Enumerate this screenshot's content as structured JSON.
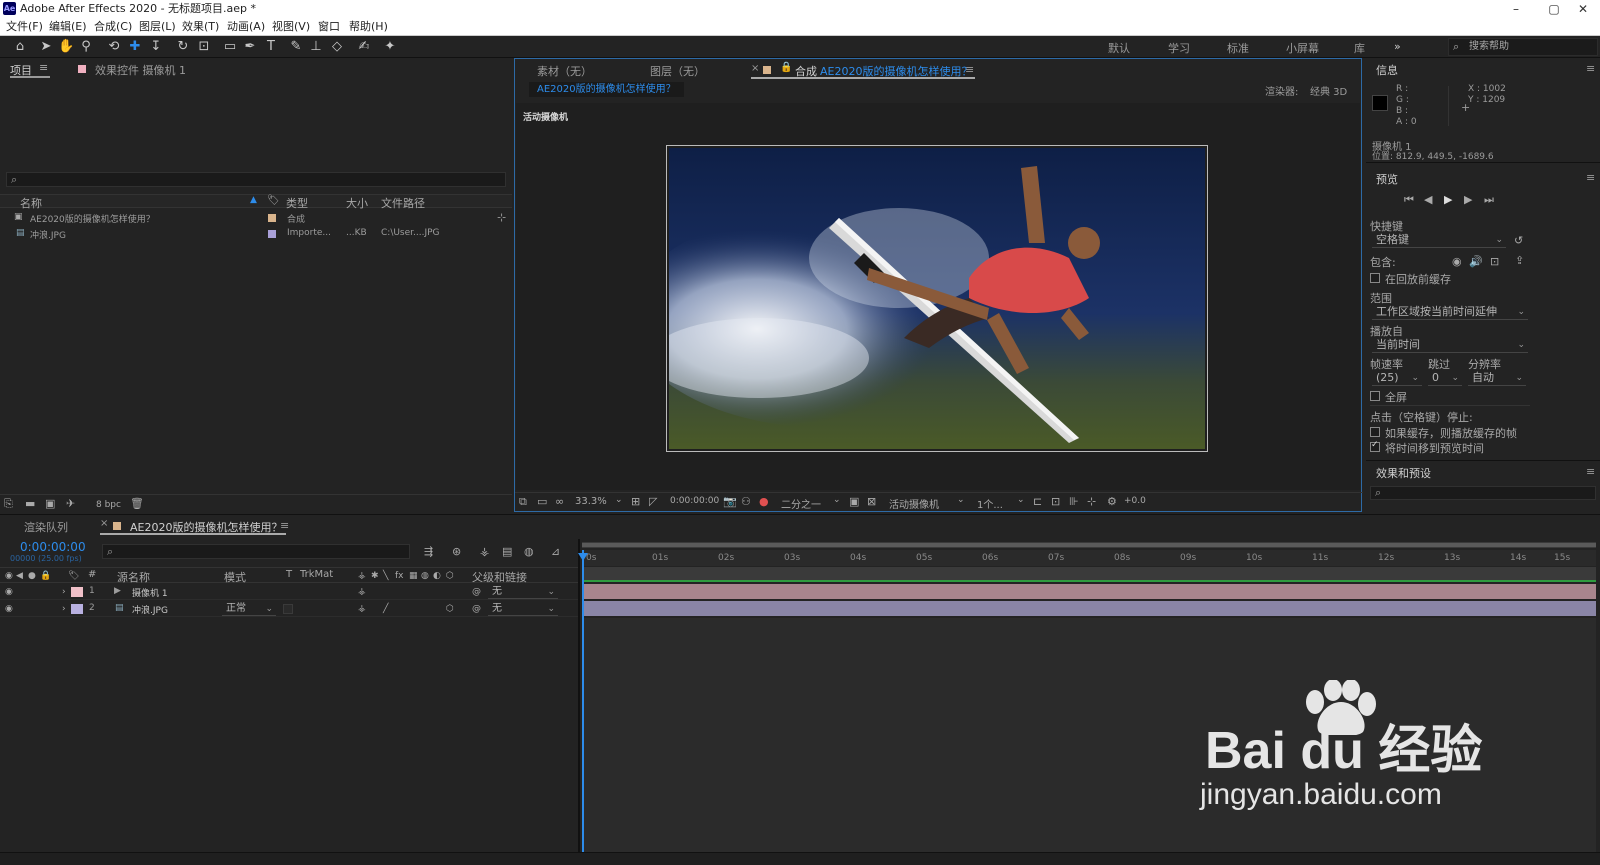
{
  "window": {
    "title": "Adobe After Effects 2020 - 无标题项目.aep *",
    "logo": "Ae",
    "controls": {
      "minimize": "–",
      "maximize": "▢",
      "close": "✕"
    }
  },
  "menu": [
    "文件(F)",
    "编辑(E)",
    "合成(C)",
    "图层(L)",
    "效果(T)",
    "动画(A)",
    "视图(V)",
    "窗口",
    "帮助(H)"
  ],
  "workspaces": [
    "默认",
    "学习",
    "标准",
    "小屏幕",
    "库"
  ],
  "workspace_more": "»",
  "search_help": "搜索帮助",
  "project_panel": {
    "tab_project": "项目",
    "tab_effects": "效果控件 摄像机 1",
    "search_icon": "⌕",
    "columns": [
      "名称",
      "类型",
      "大小",
      "文件路径"
    ],
    "rows": [
      {
        "name": "AE2020版的摄像机怎样使用？",
        "type": "合成",
        "size": "",
        "path": "",
        "label_color": "#d9b48c"
      },
      {
        "name": "冲浪.JPG",
        "type": "Importe...",
        "size": "...KB",
        "path": "C:\\User....JPG",
        "label_color": "#a9a0d8"
      }
    ],
    "bpc": "8 bpc"
  },
  "comp_viewer": {
    "tab_footage": "素材（无）",
    "tab_layer": "图层（无）",
    "tab_comp_prefix": "合成",
    "tab_comp_name": "AE2020版的摄像机怎样使用？",
    "breadcrumb": "AE2020版的摄像机怎样使用？",
    "renderer_label": "渲染器:",
    "renderer_value": "经典 3D",
    "active_camera_label": "活动摄像机",
    "zoom": "33.3%",
    "timecode": "0:00:00:00",
    "resolution": "二分之一",
    "view": "活动摄像机",
    "views_count": "1个...",
    "exposure": "+0.0"
  },
  "info_panel": {
    "title": "信息",
    "r": "R :",
    "g": "G :",
    "b": "B :",
    "a": "A : 0",
    "x": "X : 1002",
    "y": "Y : 1209",
    "camera": "摄像机 1",
    "position": "位置: 812.9, 449.5, -1689.6"
  },
  "preview_panel": {
    "title": "预览",
    "shortcut_label": "快捷键",
    "shortcut_value": "空格键",
    "include_label": "包含:",
    "cache_label": "在回放前缓存",
    "range_label": "范围",
    "range_value": "工作区域按当前时间延伸",
    "play_from_label": "播放自",
    "play_from_value": "当前时间",
    "fps_label": "帧速率",
    "skip_label": "跳过",
    "res_label": "分辨率",
    "fps_value": "(25)",
    "skip_value": "0",
    "res_value": "自动",
    "fullscreen_label": "全屏",
    "stop_label": "点击（空格键）停止:",
    "opt1": "如果缓存，则播放缓存的帧",
    "opt2": "将时间移到预览时间"
  },
  "effects_panel": {
    "title": "效果和预设"
  },
  "timeline": {
    "tab_render": "渲染队列",
    "tab_comp": "AE2020版的摄像机怎样使用？",
    "timecode": "0:00:00:00",
    "fps": "00000 (25.00 fps)",
    "columns": {
      "num": "#",
      "source": "源名称",
      "mode": "模式",
      "t": "T",
      "trkmat": "TrkMat",
      "parent": "父级和链接"
    },
    "layers": [
      {
        "num": "1",
        "name": "摄像机 1",
        "mode": "",
        "parent": "无",
        "color": "#f0c0c8",
        "bar": "#a8858d"
      },
      {
        "num": "2",
        "name": "冲浪.JPG",
        "mode": "正常",
        "parent": "无",
        "color": "#b8b0e0",
        "bar": "#8a85a6"
      }
    ],
    "ruler": [
      "0s",
      "01s",
      "02s",
      "03s",
      "04s",
      "05s",
      "06s",
      "07s",
      "08s",
      "09s",
      "10s",
      "11s",
      "12s",
      "13s",
      "14s",
      "15s"
    ]
  },
  "watermark": {
    "brand": "Bai du 经验",
    "url": "jingyan.baidu.com"
  }
}
